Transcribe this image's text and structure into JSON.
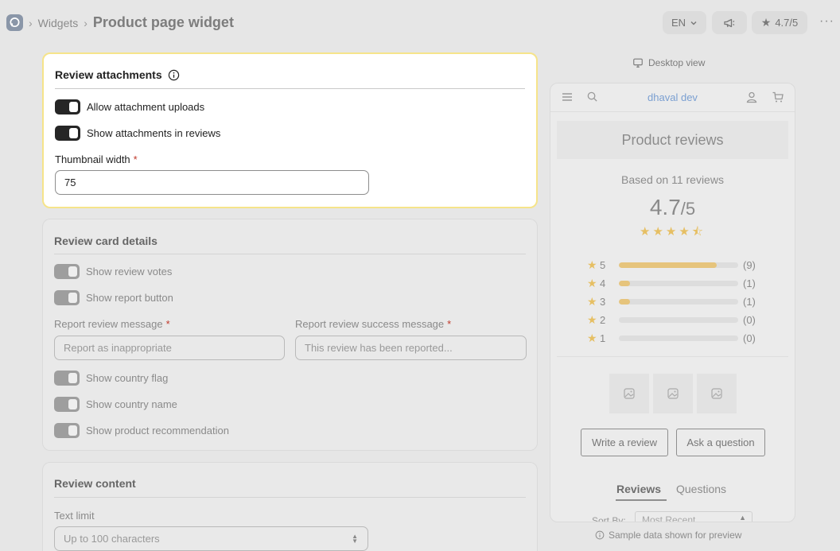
{
  "header": {
    "breadcrumb": [
      "Widgets"
    ],
    "page_title": "Product page widget",
    "language": "EN",
    "rating_badge": "4.7/5",
    "more": "···"
  },
  "review_attachments": {
    "title": "Review attachments",
    "allow_uploads_label": "Allow attachment uploads",
    "allow_uploads_on": true,
    "show_attachments_label": "Show attachments in reviews",
    "show_attachments_on": true,
    "thumbnail_width_label": "Thumbnail width",
    "required_mark": "*",
    "thumbnail_width_value": "75"
  },
  "review_card_details": {
    "title": "Review card details",
    "show_votes_label": "Show review votes",
    "show_report_label": "Show report button",
    "report_message_label": "Report review message",
    "report_message_placeholder": "Report as inappropriate",
    "report_success_label": "Report review success message",
    "report_success_placeholder": "This review has been reported...",
    "show_flag_label": "Show country flag",
    "show_country_label": "Show country name",
    "show_recommendation_label": "Show product recommendation"
  },
  "review_content": {
    "title": "Review content",
    "text_limit_label": "Text limit",
    "text_limit_value": "Up to 100 characters"
  },
  "preview": {
    "desktop_view_label": "Desktop view",
    "brand": "dhaval dev",
    "title": "Product reviews",
    "based_on": "Based on 11 reviews",
    "score": "4.7",
    "score_den": "/5",
    "stars": "★★★★⯪",
    "distribution": [
      {
        "stars": "5",
        "count": "(9)",
        "fraction": 0.82
      },
      {
        "stars": "4",
        "count": "(1)",
        "fraction": 0.09
      },
      {
        "stars": "3",
        "count": "(1)",
        "fraction": 0.09
      },
      {
        "stars": "2",
        "count": "(0)",
        "fraction": 0
      },
      {
        "stars": "1",
        "count": "(0)",
        "fraction": 0
      }
    ],
    "write_review": "Write a review",
    "ask_question": "Ask a question",
    "tab_reviews": "Reviews",
    "tab_questions": "Questions",
    "sort_label": "Sort By:",
    "sort_value": "Most Recent"
  },
  "sample_note": "Sample data shown for preview"
}
